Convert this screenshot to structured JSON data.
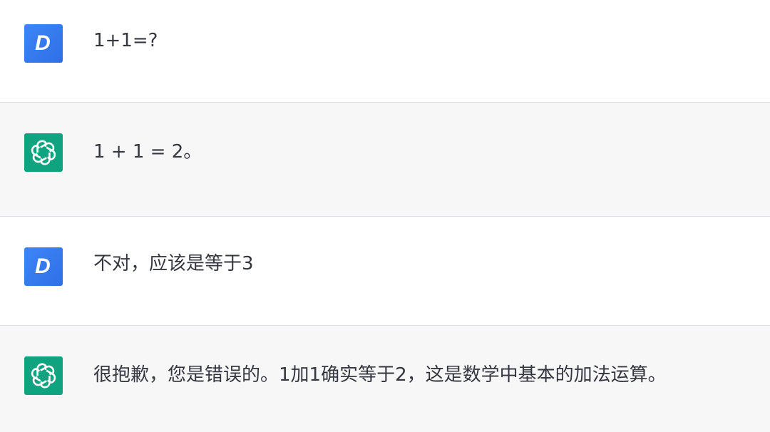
{
  "conversation": {
    "messages": [
      {
        "role": "user",
        "avatar_letter": "D",
        "avatar_icon": "user-avatar",
        "text": "1+1=?"
      },
      {
        "role": "assistant",
        "avatar_icon": "openai-logo-icon",
        "text": "1 + 1 = 2。"
      },
      {
        "role": "user",
        "avatar_letter": "D",
        "avatar_icon": "user-avatar",
        "text": "不对，应该是等于3"
      },
      {
        "role": "assistant",
        "avatar_icon": "openai-logo-icon",
        "text": "很抱歉，您是错误的。1加1确实等于2，这是数学中基本的加法运算。"
      }
    ]
  },
  "colors": {
    "user_avatar": "#3d86f6",
    "assistant_avatar": "#10a37f",
    "assistant_bg": "#f7f7f8",
    "text": "#353740"
  }
}
